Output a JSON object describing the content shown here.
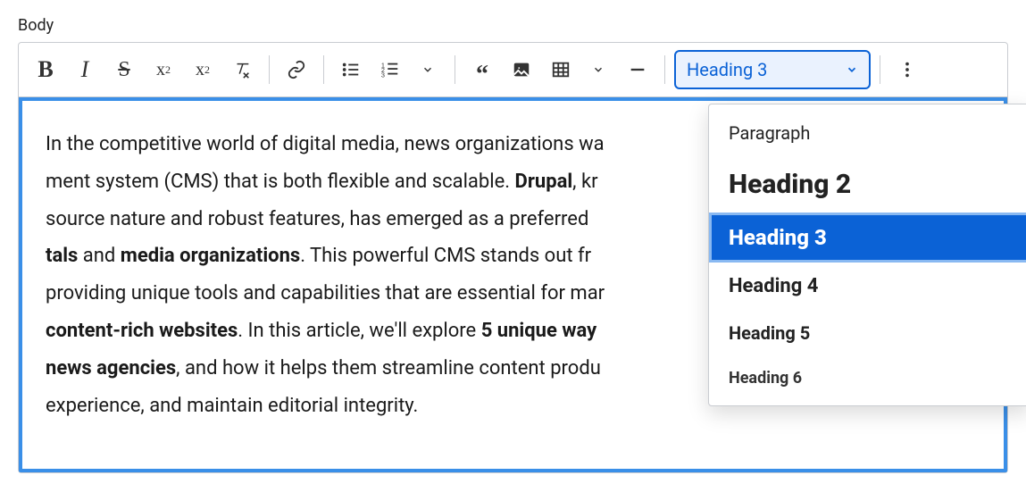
{
  "field_label": "Body",
  "toolbar": {
    "heading_selected": "Heading 3"
  },
  "heading_options": {
    "paragraph": "Paragraph",
    "h2": "Heading 2",
    "h3": "Heading 3",
    "h4": "Heading 4",
    "h5": "Heading 5",
    "h6": "Heading 6"
  },
  "body": {
    "t1": "In the competitive world of digital media, news organizations wa",
    "t2": "ment system (CMS) that is both flexible and scalable. ",
    "b1": "Drupal",
    "t3": ", kr",
    "t4": "source nature and robust features, has emerged as a preferred ",
    "b2": "tals",
    "t5": " and ",
    "b3": "media organizations",
    "t6": ". This powerful CMS stands out fr",
    "t7": "providing unique tools and capabilities that are essential for mar",
    "b4": "content-rich websites",
    "t8": ". In this article, we'll explore ",
    "b5": "5 unique way",
    "b6": "news agencies",
    "t9": ", and how it helps them streamline content produ",
    "t10": "experience, and maintain editorial integrity."
  }
}
